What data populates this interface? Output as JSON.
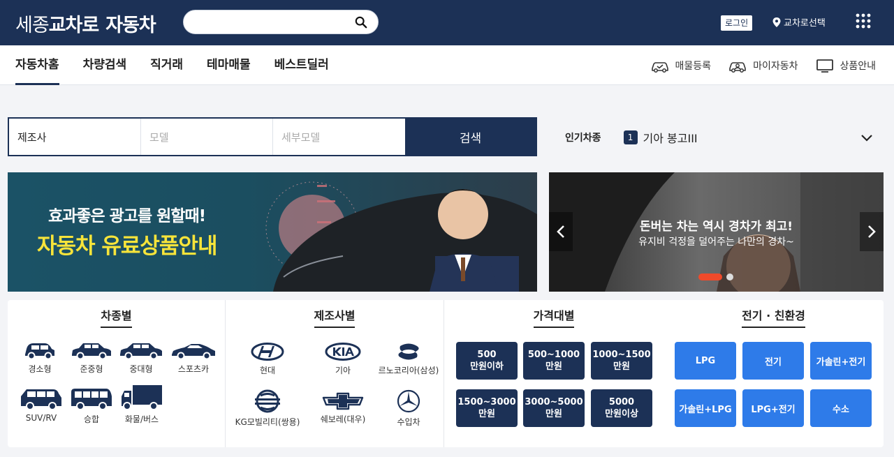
{
  "header": {
    "logo_part1": "세종",
    "logo_part2": "교차로",
    "logo_part3": "자동차",
    "search_placeholder": "",
    "login_label": "로그인",
    "location_label": "교차로선택"
  },
  "nav": {
    "tabs": [
      {
        "label": "자동차홈",
        "active": true
      },
      {
        "label": "차량검색"
      },
      {
        "label": "직거래"
      },
      {
        "label": "테마매물"
      },
      {
        "label": "베스트딜러"
      }
    ],
    "links": [
      {
        "label": "매물등록",
        "icon": "car-check-icon"
      },
      {
        "label": "마이자동차",
        "icon": "my-car-icon"
      },
      {
        "label": "상품안내",
        "icon": "monitor-icon"
      }
    ]
  },
  "car_search": {
    "maker": "제조사",
    "model": "모델",
    "detail_model": "세부모델",
    "button": "검색"
  },
  "popular": {
    "label": "인기차종",
    "rank": "1",
    "name": "기아 봉고III"
  },
  "banner_ad": {
    "line1": "효과좋은 광고를 원할때!",
    "line2": "자동차 유료상품안내"
  },
  "banner_slide": {
    "line1": "돈버는 차는 역시 경차가 최고!",
    "line2": "유지비 걱정을 덜어주는 나만의 경차~",
    "slide_count": 2,
    "active_slide": 1
  },
  "categories": {
    "by_type": {
      "title": "차종별",
      "items": [
        "경소형",
        "준중형",
        "중대형",
        "스포츠카",
        "SUV/RV",
        "승합",
        "화물/버스"
      ]
    },
    "by_maker": {
      "title": "제조사별",
      "items": [
        "현대",
        "기아",
        "르노코리아(삼성)",
        "KG모빌리티(쌍용)",
        "쉐보레(대우)",
        "수입차"
      ]
    },
    "by_price": {
      "title": "가격대별",
      "items": [
        {
          "l1": "500",
          "l2": "만원이하"
        },
        {
          "l1": "500~1000",
          "l2": "만원"
        },
        {
          "l1": "1000~1500",
          "l2": "만원"
        },
        {
          "l1": "1500~3000",
          "l2": "만원"
        },
        {
          "l1": "3000~5000",
          "l2": "만원"
        },
        {
          "l1": "5000",
          "l2": "만원이상"
        }
      ]
    },
    "by_fuel": {
      "title": "전기 · 친환경",
      "items": [
        "LPG",
        "전기",
        "가솔린+전기",
        "가솔린+LPG",
        "LPG+전기",
        "수소"
      ]
    }
  },
  "colors": {
    "navy": "#1c3156",
    "blue": "#2e7be9",
    "accent_red": "#f04a2a",
    "yellow": "#f7e43a"
  }
}
